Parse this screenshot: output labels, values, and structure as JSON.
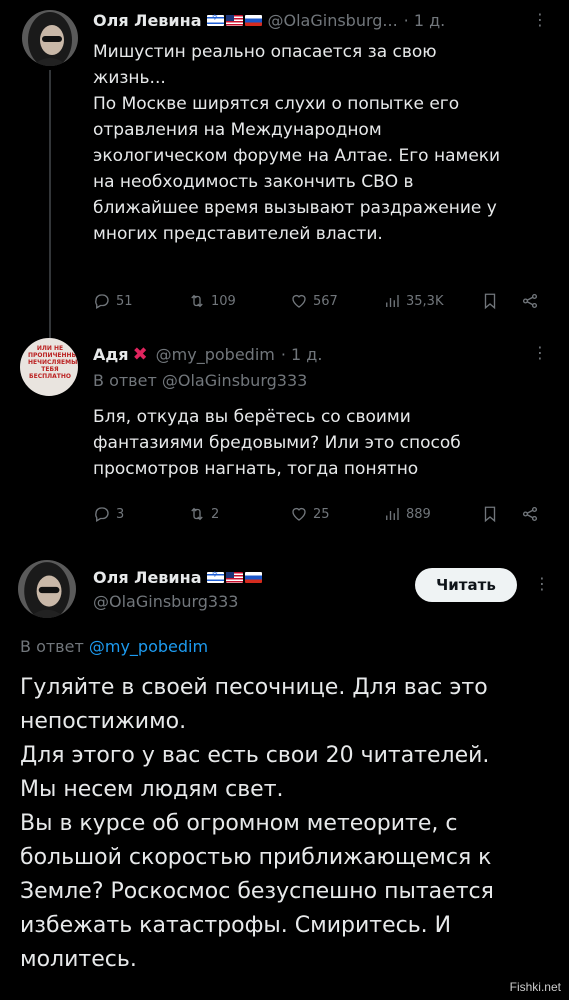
{
  "tweet1": {
    "name": "Оля Левина",
    "handle": "@OlaGinsburg...",
    "time": "· 1 д.",
    "more": "⋮",
    "text": "Мишустин реально опасается за свою\nжизнь...\nПо Москве ширятся слухи о попытке его\nотравления на Международном\nэкологическом форуме на Алтае. Его намеки\nна необходимость закончить СВО в\nближайшее время вызывают раздражение у\nмногих представителей власти.",
    "replies": "51",
    "retweets": "109",
    "likes": "567",
    "views": "35,3K"
  },
  "tweet2": {
    "name": "Адя",
    "handle": "@my_pobedim",
    "time": "· 1 д.",
    "more": "⋮",
    "reply_prefix": "В ответ",
    "reply_handle": "@OlaGinsburg333",
    "avatar_sign": "ИЛИ НЕ\nПРОПИЧЕННЫМ\nНЕЧИСЛЯЕМЫМ\nТЕБЯ\nБЕСПЛАТНО",
    "text": "Бля, откуда вы берётесь со своими\nфантазиями бредовыми? Или это способ\nпросмотров нагнать, тогда понятно",
    "replies": "3",
    "retweets": "2",
    "likes": "25",
    "views": "889"
  },
  "tweet3": {
    "name": "Оля Левина",
    "handle": "@OlaGinsburg333",
    "follow_label": "Читать",
    "more": "⋮",
    "reply_prefix": "В ответ",
    "reply_handle": "@my_pobedim",
    "text": "Гуляйте в своей песочнице. Для вас это\nнепостижимо.\nДля этого у вас есть свои 20 читателей.\nМы несем людям свет.\nВы в курсе об огромном метеорите, с\nбольшой скоростью приближающемся к\nЗемле? Роскосмос безуспешно пытается\nизбежать катастрофы. Смиритесь. И\nмолитесь."
  },
  "watermark": "Fishki.net",
  "colors": {
    "background": "#000000",
    "text": "#e7e9ea",
    "muted": "#71767b",
    "link": "#1d9bf0",
    "verified_x": "#e0245e"
  }
}
